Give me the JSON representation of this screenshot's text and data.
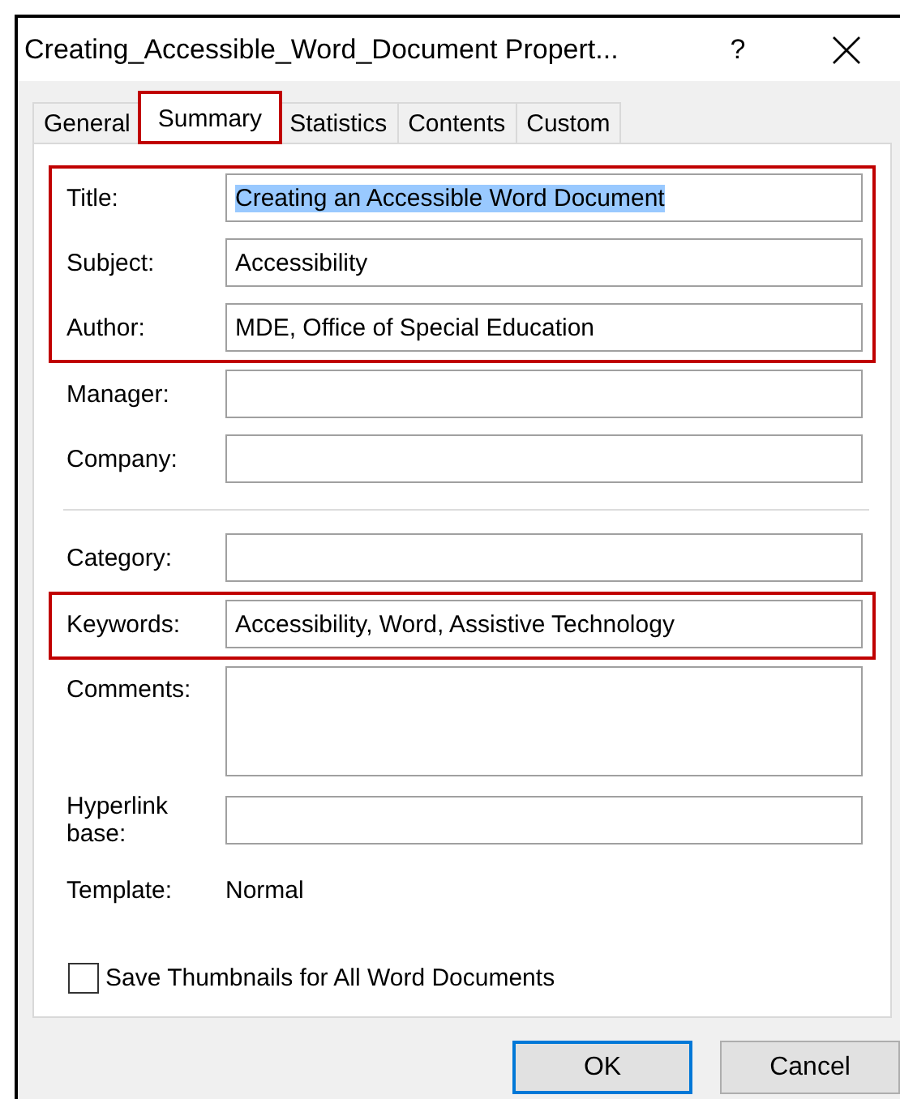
{
  "window": {
    "title": "Creating_Accessible_Word_Document Propert...",
    "help": "?"
  },
  "tabs": [
    {
      "label": "General",
      "selected": false,
      "highlighted": false
    },
    {
      "label": "Summary",
      "selected": true,
      "highlighted": true
    },
    {
      "label": "Statistics",
      "selected": false,
      "highlighted": false
    },
    {
      "label": "Contents",
      "selected": false,
      "highlighted": false
    },
    {
      "label": "Custom",
      "selected": false,
      "highlighted": false
    }
  ],
  "summary": {
    "groups": [
      {
        "highlighted": true,
        "rule_above": false,
        "fields": [
          {
            "kind": "line",
            "label": "Title:",
            "value": "Creating an Accessible Word Document",
            "selected": true
          },
          {
            "kind": "line",
            "label": "Subject:",
            "value": "Accessibility",
            "selected": false
          },
          {
            "kind": "line",
            "label": "Author:",
            "value": "MDE, Office of Special Education",
            "selected": false
          }
        ]
      },
      {
        "highlighted": false,
        "rule_above": false,
        "fields": [
          {
            "kind": "line",
            "label": "Manager:"
          },
          {
            "kind": "line",
            "label": "Company:"
          }
        ]
      },
      {
        "highlighted": false,
        "rule_above": true,
        "fields": [
          {
            "kind": "line",
            "label": "Category:"
          }
        ]
      },
      {
        "highlighted": true,
        "rule_above": false,
        "fields": [
          {
            "kind": "line",
            "label": "Keywords:",
            "value": "Accessibility, Word, Assistive Technology",
            "selected": false
          }
        ]
      },
      {
        "highlighted": false,
        "rule_above": false,
        "fields": [
          {
            "kind": "multiline",
            "label": "Comments:"
          },
          {
            "kind": "line",
            "label": "Hyperlink base:"
          },
          {
            "kind": "static",
            "label": "Template:",
            "value": "Normal"
          }
        ]
      }
    ],
    "checkbox": {
      "label": "Save Thumbnails for All Word Documents",
      "checked": false
    }
  },
  "buttons": [
    {
      "label": "OK",
      "default": true
    },
    {
      "label": "Cancel",
      "default": false
    }
  ]
}
